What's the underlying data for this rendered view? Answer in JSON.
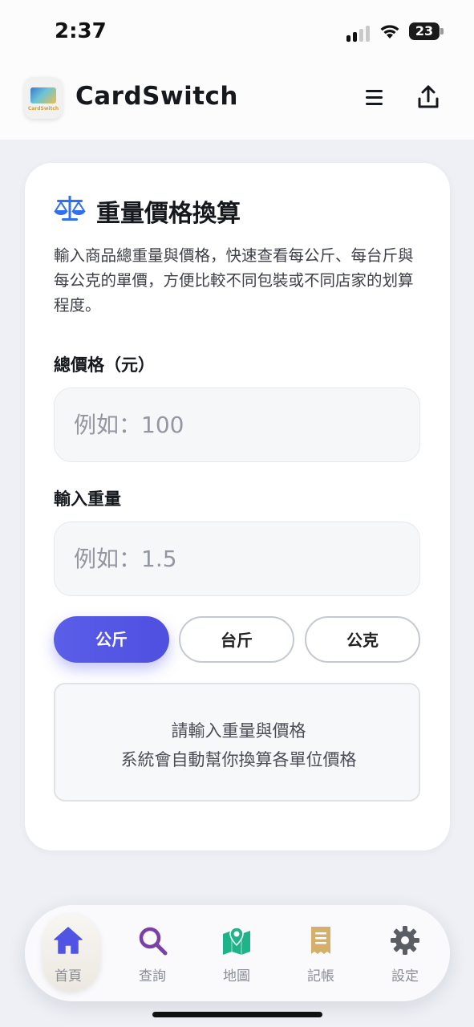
{
  "status_bar": {
    "time": "2:37",
    "battery": "23"
  },
  "header": {
    "app_name": "CardSwitch",
    "logo_text": "CardSwitch"
  },
  "card": {
    "title": "重量價格換算",
    "description": "輸入商品總重量與價格，快速查看每公斤、每台斤與每公克的單價，方便比較不同包裝或不同店家的划算程度。",
    "price_label": "總價格（元）",
    "price_placeholder": "例如：100",
    "weight_label": "輸入重量",
    "weight_placeholder": "例如：1.5",
    "units": [
      {
        "label": "公斤",
        "active": true
      },
      {
        "label": "台斤",
        "active": false
      },
      {
        "label": "公克",
        "active": false
      }
    ],
    "result_line1": "請輸入重量與價格",
    "result_line2": "系統會自動幫你換算各單位價格"
  },
  "nav": [
    {
      "label": "首頁",
      "icon": "home-icon",
      "active": true
    },
    {
      "label": "查詢",
      "icon": "search-icon",
      "active": false
    },
    {
      "label": "地圖",
      "icon": "map-icon",
      "active": false
    },
    {
      "label": "記帳",
      "icon": "receipt-icon",
      "active": false
    },
    {
      "label": "設定",
      "icon": "gear-icon",
      "active": false
    }
  ],
  "colors": {
    "accent": "#5154e3",
    "scale_icon": "#2f6ff0",
    "search": "#7b3fa8",
    "map": "#1fb38a",
    "receipt": "#d4b06a",
    "gear": "#5a5d64"
  }
}
